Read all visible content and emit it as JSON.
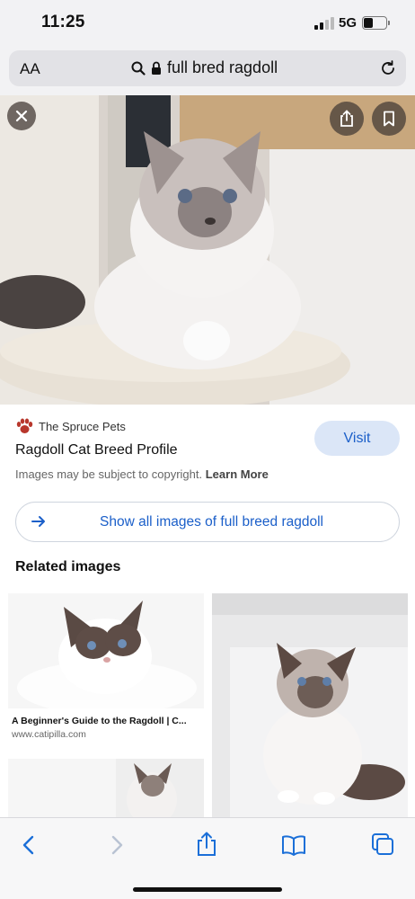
{
  "status_bar": {
    "time": "11:25",
    "network": "5G"
  },
  "browser": {
    "text_size": "AA",
    "url": "full bred ragdoll"
  },
  "result": {
    "source": "The Spruce Pets",
    "title": "Ragdoll Cat Breed Profile",
    "visit_label": "Visit",
    "copyright_text": "Images may be subject to copyright.",
    "learn_more": "Learn More",
    "show_all_label": "Show all images of full breed ragdoll"
  },
  "related": {
    "heading": "Related images",
    "items": [
      {
        "caption": "A Beginner's Guide to the Ragdoll | C...",
        "site": "www.catipilla.com"
      }
    ]
  },
  "colors": {
    "accent": "#1b5fc9",
    "visit_bg": "#dbe6f7",
    "paw": "#b8372c"
  },
  "icons": {
    "close": "close-icon",
    "share": "share-icon",
    "bookmark": "bookmark-icon",
    "back": "chevron-left-icon",
    "forward": "chevron-right-icon",
    "bookmarks": "book-icon",
    "tabs": "tabs-icon"
  }
}
